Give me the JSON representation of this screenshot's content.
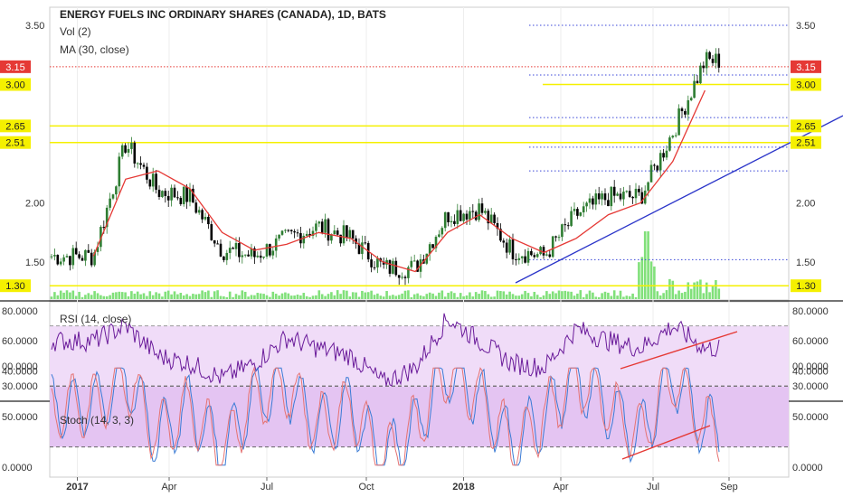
{
  "header": {
    "title": "ENERGY FUELS INC ORDINARY SHARES (CANADA), 1D, BATS",
    "vol_label": "Vol (2)",
    "ma_label": "MA (30, close)"
  },
  "colors": {
    "up_candle": "#2e7d32",
    "down_candle": "#000000",
    "ma_line": "#e53935",
    "volume": "#81e07a",
    "trendline": "#2b35c9",
    "highlight_line": "#f5f000",
    "fib_dotted": "#3a46d8",
    "price_dotted": "#e53935",
    "rsi_line": "#6a1b9a",
    "rsi_band": "#f0dcf8",
    "stoch_band": "#e4c4f2",
    "stoch_k": "#3a7bd5",
    "stoch_d": "#e57373"
  },
  "chart_data": [
    {
      "type": "line",
      "panel": "price",
      "title": "ENERGY FUELS INC ORDINARY SHARES (CANADA), 1D, BATS",
      "x_ticks": [
        "2017",
        "Apr",
        "Jul",
        "Oct",
        "2018",
        "Apr",
        "Jul",
        "Sep"
      ],
      "y_ticks": [
        "1.50",
        "2.00",
        "3.50"
      ],
      "ylim": [
        1.3,
        3.65
      ],
      "series": [
        {
          "name": "",
          "x": [
            "2017-01",
            "2017-02",
            "2017-03",
            "2017-04",
            "2017-05",
            "2017-06",
            "2017-07",
            "2017-08",
            "2017-09",
            "2017-10",
            "2017-11",
            "2017-12",
            "2018-01",
            "2018-02",
            "2018-03",
            "2018-04",
            "2018-05",
            "2018-06",
            "2018-07",
            "2018-08"
          ],
          "values": [
            1.55,
            2.5,
            2.1,
            2.05,
            1.6,
            1.55,
            1.7,
            1.8,
            1.7,
            1.45,
            1.45,
            1.9,
            1.95,
            1.6,
            1.55,
            1.9,
            2.05,
            2.05,
            2.6,
            3.2
          ]
        },
        {
          "name": "MA (30, close)",
          "x": [
            "2017-01",
            "2017-02",
            "2017-03",
            "2017-04",
            "2017-05",
            "2017-06",
            "2017-07",
            "2017-08",
            "2017-09",
            "2017-10",
            "2017-11",
            "2017-12",
            "2018-01",
            "2018-02",
            "2018-03",
            "2018-04",
            "2018-05",
            "2018-06",
            "2018-07",
            "2018-08"
          ],
          "values": [
            1.55,
            2.2,
            2.27,
            2.12,
            1.75,
            1.6,
            1.65,
            1.75,
            1.7,
            1.5,
            1.42,
            1.75,
            1.9,
            1.7,
            1.58,
            1.7,
            1.9,
            2.0,
            2.35,
            2.95
          ]
        }
      ],
      "markers": [
        "3.15",
        "3.00",
        "2.65",
        "2.51",
        "1.30"
      ]
    },
    {
      "type": "line",
      "panel": "rsi",
      "title": "RSI (14, close)",
      "y_ticks": [
        "80.0000",
        "60.0000",
        "40.0000",
        "30.0000"
      ],
      "ylim": [
        28,
        82
      ],
      "bands": [
        30,
        70
      ],
      "series": [
        {
          "name": "RSI (14, close)",
          "x": [
            "2017-01",
            "2017-02",
            "2017-03",
            "2017-04",
            "2017-05",
            "2017-06",
            "2017-07",
            "2017-08",
            "2017-09",
            "2017-10",
            "2017-11",
            "2017-12",
            "2018-01",
            "2018-02",
            "2018-03",
            "2018-04",
            "2018-05",
            "2018-06",
            "2018-07",
            "2018-08"
          ],
          "values": [
            60,
            70,
            50,
            45,
            35,
            45,
            62,
            55,
            50,
            32,
            42,
            75,
            60,
            45,
            42,
            68,
            60,
            55,
            70,
            55
          ]
        }
      ]
    },
    {
      "type": "line",
      "panel": "stoch",
      "title": "Stoch (14, 3, 3)",
      "y_ticks": [
        "00.0000",
        "50.0000",
        "0.0000"
      ],
      "ylim": [
        0,
        100
      ],
      "bands": [
        20,
        80
      ],
      "series": [
        {
          "name": "Stoch (14, 3, 3)",
          "x": [
            "2017-01",
            "2017-02",
            "2017-03",
            "2017-04",
            "2017-05",
            "2017-06",
            "2017-07",
            "2017-08",
            "2017-09",
            "2017-10",
            "2017-11",
            "2017-12",
            "2018-01",
            "2018-02",
            "2018-03",
            "2018-04",
            "2018-05",
            "2018-06",
            "2018-07",
            "2018-08"
          ],
          "values": [
            60,
            90,
            30,
            60,
            15,
            70,
            80,
            40,
            60,
            5,
            40,
            95,
            70,
            20,
            50,
            90,
            60,
            30,
            90,
            40
          ]
        }
      ]
    }
  ],
  "rsi_label": "RSI (14, close)",
  "stoch_label": "Stoch (14, 3, 3)"
}
